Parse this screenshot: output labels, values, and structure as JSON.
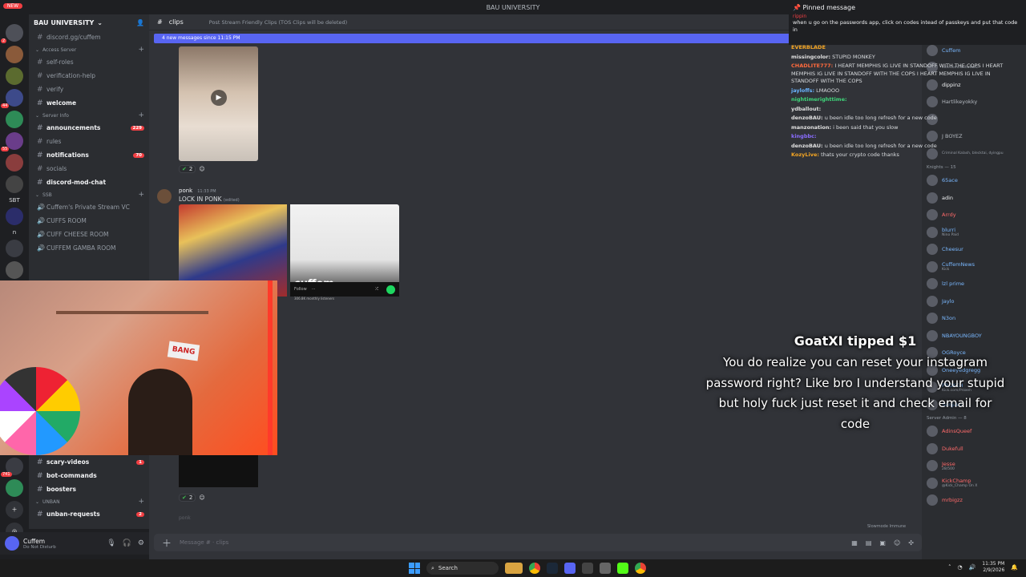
{
  "window": {
    "title": "BAU UNIVERSITY"
  },
  "rail": {
    "new_badge": "NEW",
    "sbt_label": "SBT",
    "n_label": "n",
    "badges": [
      "2",
      "44",
      "55",
      "741"
    ]
  },
  "guild": {
    "name": "BAU UNIVERSITY",
    "invite": "discord.gg/cuffem",
    "channels": [
      {
        "type": "cat",
        "label": "Access Server"
      },
      {
        "type": "text",
        "label": "self-roles"
      },
      {
        "type": "text",
        "label": "verification-help"
      },
      {
        "type": "text",
        "label": "verify"
      },
      {
        "type": "text-bold",
        "label": "welcome"
      },
      {
        "type": "cat",
        "label": "Server Info"
      },
      {
        "type": "text-bold",
        "label": "announcements",
        "count": "229"
      },
      {
        "type": "text",
        "label": "rules"
      },
      {
        "type": "text-bold",
        "label": "notifications",
        "count": "70"
      },
      {
        "type": "text",
        "label": "socials"
      },
      {
        "type": "text-bold",
        "label": "discord-mod-chat"
      },
      {
        "type": "cat",
        "label": "SSB"
      },
      {
        "type": "voice",
        "label": "Cuffem's Private Stream VC"
      },
      {
        "type": "voice",
        "label": "CUFFS ROOM"
      },
      {
        "type": "voice",
        "label": "CUFF CHEESE ROOM"
      },
      {
        "type": "voice",
        "label": "CUFFEM GAMBA ROOM"
      }
    ],
    "lower_channels": [
      {
        "type": "text-bold",
        "label": "scary-videos",
        "count": "1"
      },
      {
        "type": "text-bold",
        "label": "bot-commands"
      },
      {
        "type": "text-bold",
        "label": "boosters"
      },
      {
        "type": "cat",
        "label": "UNBAN"
      },
      {
        "type": "text-bold",
        "label": "unban-requests",
        "count": "2"
      }
    ]
  },
  "user": {
    "name": "Cuffem",
    "status": "Do Not Disturb"
  },
  "channel": {
    "name": "clips",
    "topic": "Post Stream Friendly Clips (TOS Clips will be deleted)"
  },
  "chat": {
    "new_messages": "4 new messages since 11:15 PM",
    "reaction1": "2",
    "author": "ponk",
    "time": "11:33 PM",
    "message": "LOCK IN PONK",
    "edited": "(edited)",
    "embed_name": "cuffem",
    "embed_sub": "306.8K monthly listeners",
    "embed_follow": "Follow",
    "reaction2": "2",
    "next_author": "ponk",
    "composer_placeholder": "Message # · clips",
    "slowmode": "Slowmode Immune"
  },
  "cam": {
    "sign": "BANG"
  },
  "pinned": {
    "title": "Pinned message",
    "author": "rippin",
    "text": "when u go on the passwords app, click on codes intead of passkeys and put that code in"
  },
  "chatlog": [
    {
      "name": "EVERBLADE",
      "color": "#f5a623",
      "text": ""
    },
    {
      "name": "missingcolor:",
      "color": "#e0e0e0",
      "text": "STUPID MONKEY"
    },
    {
      "name": "CHADLITE777:",
      "color": "#ff6a3d",
      "text": "I HEART MEMPHIS IG LIVE IN STANDOFF WITH THE COPS I HEART MEMPHIS IG LIVE IN STANDOFF WITH THE COPS I HEART MEMPHIS IG LIVE IN STANDOFF WITH THE COPS"
    },
    {
      "name": "jayloffs:",
      "color": "#6ab4ff",
      "text": "LMAOOO"
    },
    {
      "name": "nightimerighttime:",
      "color": "#3fd67a",
      "text": ""
    },
    {
      "name": "ydballout:",
      "color": "#e0e0e0",
      "text": ""
    },
    {
      "name": "denzoBAU:",
      "color": "#e0e0e0",
      "text": "u been idle too long refresh for a new code"
    },
    {
      "name": "manzonation:",
      "color": "#e0e0e0",
      "text": "i been said that you slow"
    },
    {
      "name": "kingbbc:",
      "color": "#8a6dff",
      "text": ""
    },
    {
      "name": "denzoBAU:",
      "color": "#e0e0e0",
      "text": "u been idle too long refresh for a new code"
    },
    {
      "name": "KozyLive:",
      "color": "#f5a623",
      "text": "thats your crypto code thanks"
    }
  ],
  "members": {
    "groups": [
      {
        "label": "Cuffem — 1",
        "items": [
          {
            "name": "Cuffem",
            "color": "#7ab8ff",
            "sub": ""
          }
        ]
      },
      {
        "label": "",
        "items": [
          {
            "name": "",
            "color": "#b5bac1",
            "sub": "kick.com/TashaToxic"
          },
          {
            "name": "dippinz",
            "color": "#f2f3f5",
            "sub": ""
          },
          {
            "name": "Hartlikeyokky",
            "color": "#b5bac1",
            "sub": ""
          },
          {
            "name": "",
            "color": "#b5bac1",
            "sub": ""
          },
          {
            "name": "J BOYEZ",
            "color": "#b5bac1",
            "sub": ""
          },
          {
            "name": "",
            "color": "#b5bac1",
            "sub": "Criminal Kalash, blecktai, dyingpu"
          }
        ]
      },
      {
        "label": "Knights — 15",
        "items": [
          {
            "name": "65ace",
            "color": "#7ab8ff",
            "sub": ""
          },
          {
            "name": "adin",
            "color": "#f2f3f5",
            "sub": ""
          },
          {
            "name": "Arrdy",
            "color": "#ff6a6a",
            "sub": ""
          },
          {
            "name": "blurri",
            "color": "#7ab8ff",
            "sub": "Nino Paid"
          },
          {
            "name": "Cheesur",
            "color": "#7ab8ff",
            "sub": ""
          },
          {
            "name": "CuffemNews",
            "color": "#7ab8ff",
            "sub": "Kick"
          },
          {
            "name": "lzl prime",
            "color": "#7ab8ff",
            "sub": ""
          },
          {
            "name": "Jaylo",
            "color": "#7ab8ff",
            "sub": ""
          },
          {
            "name": "N3on",
            "color": "#7ab8ff",
            "sub": ""
          },
          {
            "name": "NBAYOUNGBOY",
            "color": "#7ab8ff",
            "sub": ""
          },
          {
            "name": "OGRoyce",
            "color": "#7ab8ff",
            "sub": ""
          },
          {
            "name": "Oneeyedgregg",
            "color": "#7ab8ff",
            "sub": ""
          },
          {
            "name": "PROXEH",
            "color": "#7ab8ff",
            "sub": "Kick.com/Proxeh"
          },
          {
            "name": "SanjiAU",
            "color": "#7ab8ff",
            "sub": ""
          }
        ]
      },
      {
        "label": "Server Admin — 8",
        "items": [
          {
            "name": "AdinsQueef",
            "color": "#ff6a6a",
            "sub": ""
          },
          {
            "name": "Dukefull",
            "color": "#ff6a6a",
            "sub": ""
          },
          {
            "name": "Jesse",
            "color": "#ff6a6a",
            "sub": "28/500"
          },
          {
            "name": "KickChamp",
            "color": "#ff6a6a",
            "sub": "@Kick_Champ On X"
          },
          {
            "name": "mrbigzz",
            "color": "#ff6a6a",
            "sub": ""
          }
        ]
      }
    ]
  },
  "tip": {
    "title": "GoatXI tipped $1",
    "message": "You do realize you can reset your instagram password right? Like bro I understand your stupid but holy fuck just reset it and check email for code"
  },
  "taskbar": {
    "search": "Search",
    "time": "11:35 PM",
    "date": "2/9/2026"
  },
  "colors": {
    "accent": "#5865f2",
    "danger": "#f23f43",
    "spotify": "#1ed760"
  }
}
